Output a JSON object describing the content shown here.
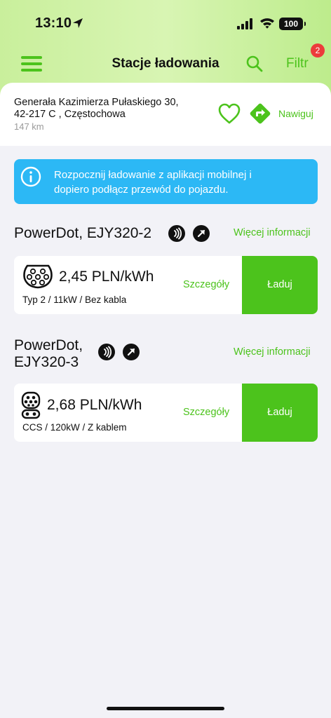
{
  "status_bar": {
    "time": "13:10",
    "battery": "100"
  },
  "nav": {
    "title": "Stacje ładowania",
    "filter_label": "Filtr",
    "filter_count": "2"
  },
  "address": {
    "line1": "Generała Kazimierza Pułaskiego 30,",
    "line2": "42-217 C , Częstochowa",
    "distance": "147 km",
    "navigate_label": "Nawiguj"
  },
  "info_banner": {
    "line1": "Rozpocznij ładowanie z aplikacji mobilnej i",
    "line2": "dopiero podłącz przewód do pojazdu."
  },
  "stations": [
    {
      "name_line1": "PowerDot, EJY320-2",
      "more_info_label": "Więcej informacji",
      "connector": {
        "price": "2,45 PLN/kWh",
        "spec": "Typ 2 / 11kW / Bez kabla",
        "details_label": "Szczegóły",
        "charge_label": "Ładuj",
        "icon": "type2-plug-icon"
      }
    },
    {
      "name_line1": "PowerDot,",
      "name_line2": "EJY320-3",
      "more_info_label": "Więcej informacji",
      "connector": {
        "price": "2,68 PLN/kWh",
        "spec": "CCS / 120kW / Z kablem",
        "details_label": "Szczegóły",
        "charge_label": "Ładuj",
        "icon": "ccs-plug-icon"
      }
    }
  ],
  "colors": {
    "accent": "#4cc31c",
    "info": "#2cb8f5",
    "badge": "#ec3b3b"
  }
}
